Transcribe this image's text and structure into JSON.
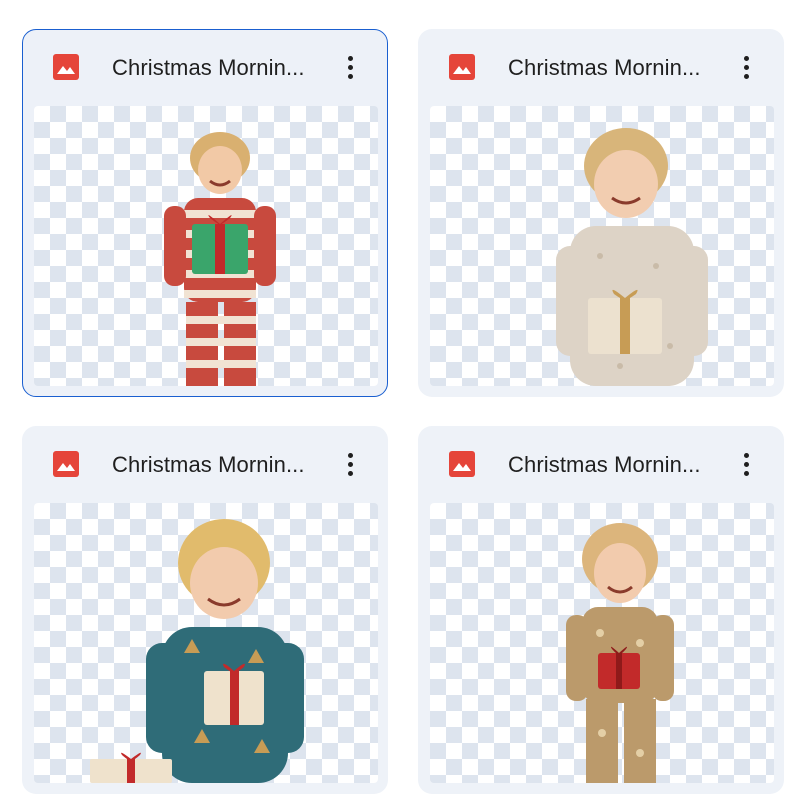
{
  "files": [
    {
      "title": "Christmas Mornin...",
      "selected": true
    },
    {
      "title": "Christmas Mornin...",
      "selected": false
    },
    {
      "title": "Christmas Mornin...",
      "selected": false
    },
    {
      "title": "Christmas Mornin...",
      "selected": false
    }
  ],
  "icons": {
    "file_type": "image-icon",
    "menu": "more-vert-icon"
  },
  "colors": {
    "accent": "#1a5fd0",
    "image_icon": "#e5453a",
    "card_bg": "#eef2f8"
  }
}
